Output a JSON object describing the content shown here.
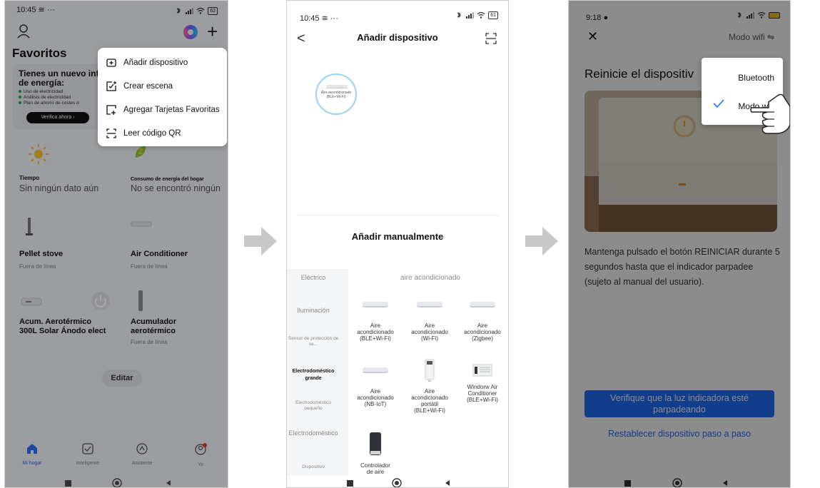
{
  "arrow_color": "#c8c8c8",
  "accent": "#1f6fff",
  "phone1": {
    "status_time": "10:45",
    "status_icons": "≅ ···",
    "battery": "62",
    "favorites_title": "Favoritos",
    "promo": {
      "title_line1": "Tienes un nuevo inf",
      "title_line2": "de energía:",
      "bullets": [
        "Uso de electricidad",
        "Análisis de electricidad",
        "Plan de ahorro de costes d"
      ],
      "button": "Verifica ahora"
    },
    "menu": {
      "items": [
        {
          "label": "Añadir dispositivo",
          "icon": "add-device-icon"
        },
        {
          "label": "Crear escena",
          "icon": "create-scene-icon"
        },
        {
          "label": "Agregar Tarjetas Favoritas",
          "icon": "add-card-icon"
        },
        {
          "label": "Leer código QR",
          "icon": "scan-qr-icon"
        }
      ]
    },
    "cards": {
      "weather": {
        "label": "Tiempo",
        "value": "Sin ningún dato aún"
      },
      "energy": {
        "label": "Consumo de energía del hogar",
        "value": "No se encontró ningún"
      },
      "pellet": {
        "name": "Pellet stove",
        "status": "Fuera de línea"
      },
      "ac": {
        "name": "Air Conditioner",
        "status": "Fuera de línea"
      },
      "acum_solar": {
        "name_line1": "Acum. Aerotérmico",
        "name_line2": "300L Solar Ánodo elect"
      },
      "acum_aero": {
        "name_line1": "Acumulador",
        "name_line2": "aerotérmico",
        "status": "Fuera de línea"
      }
    },
    "edit_button": "Editar",
    "tabs": [
      {
        "label": "Mi hogar",
        "icon": "home-icon"
      },
      {
        "label": "Inteligente",
        "icon": "smart-icon"
      },
      {
        "label": "Asistente",
        "icon": "assistant-icon"
      },
      {
        "label": "Yo",
        "icon": "profile-icon"
      }
    ]
  },
  "phone2": {
    "status_time": "10:45",
    "status_icons": "≅ ···",
    "battery": "61",
    "title": "Añadir dispositivo",
    "found_device": "Aire acondicionado (BLE+Wi-Fi)",
    "manual_title": "Añadir manualmente",
    "categories": [
      "Eléctrico",
      "Iluminación",
      "Sensor de protección de se...",
      "Electrodoméstico grande",
      "Electrodoméstico pequeño",
      "Electrodoméstico",
      "Dispositivo"
    ],
    "section_title": "aire acondicionado",
    "devices": [
      {
        "line1": "Aire",
        "line2": "acondicionado",
        "line3": "(BLE+Wi-Fi)",
        "line4": ""
      },
      {
        "line1": "Aire",
        "line2": "acondicionado",
        "line3": "(Wi-Fi)",
        "line4": ""
      },
      {
        "line1": "Aire",
        "line2": "acondicionado",
        "line3": "(Zigbee)",
        "line4": ""
      },
      {
        "line1": "Aire",
        "line2": "acondicionado",
        "line3": "(NB-IoT)",
        "line4": ""
      },
      {
        "line1": "Aire",
        "line2": "acondicionado",
        "line3": "portátil",
        "line4": "(BLE+Wi-Fi)"
      },
      {
        "line1": "Windorw Air",
        "line2": "Conditioner",
        "line3": "(BLE+Wi-Fi)",
        "line4": ""
      },
      {
        "line1": "Controlador",
        "line2": "de aire",
        "line3": "",
        "line4": ""
      }
    ]
  },
  "phone3": {
    "status_time": "9:18",
    "battery": "",
    "mode_label": "Modo wifi",
    "title": "Reinicie el dispositiv",
    "popup_options": [
      "Bluetooth",
      "Modo wifi"
    ],
    "selected_option": "Modo wifi",
    "description": "Mantenga pulsado el botón REINICIAR durante 5 segundos hasta que el indicador parpadee (sujeto al manual del usuario).",
    "verify_button": "Verifique que la luz indicadora esté parpadeando",
    "reset_link": "Restablecer dispositivo paso a paso"
  }
}
